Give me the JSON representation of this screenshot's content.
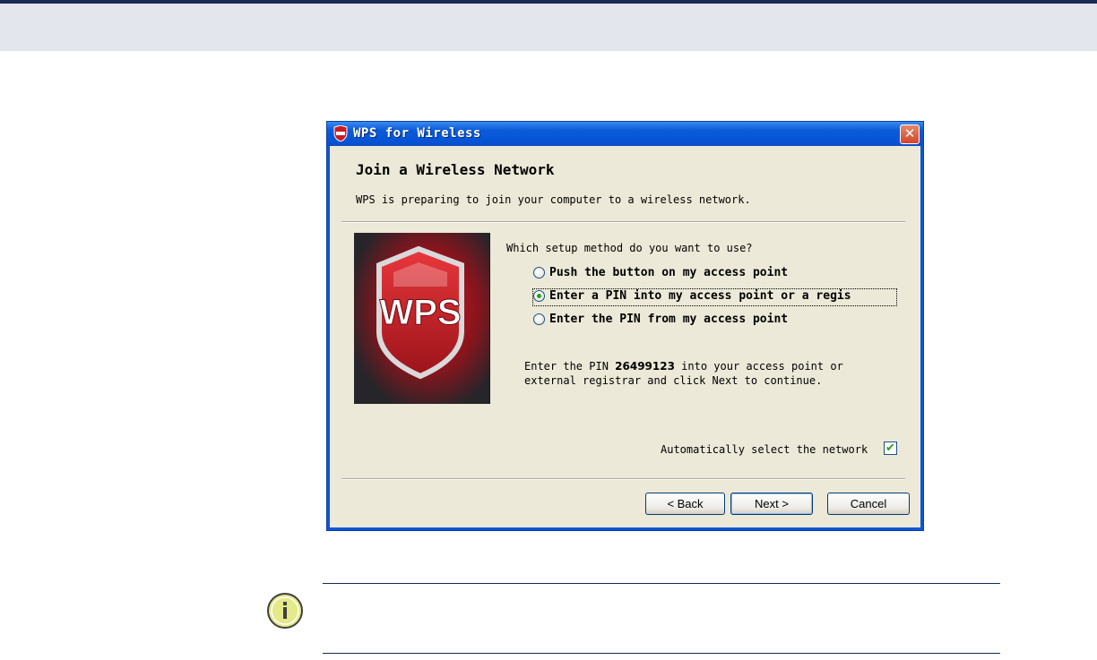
{
  "dialog": {
    "title": "WPS for Wireless",
    "close_label": "✕",
    "heading": "Join a Wireless Network",
    "subheading": "WPS is preparing to join your computer to a wireless network.",
    "banner_logo": "WPS",
    "question": "Which setup method do you want to use?",
    "options": [
      {
        "label": "Push the button on my access point",
        "selected": false
      },
      {
        "label": "Enter a PIN into my access point or a regis",
        "selected": true
      },
      {
        "label": "Enter the PIN from my access point",
        "selected": false
      }
    ],
    "pin_text_before": "Enter the PIN ",
    "pin": "26499123",
    "pin_text_after": " into your access point or external registrar and click Next to continue.",
    "auto_select_label": "Automatically select the network",
    "auto_select_checked": true,
    "buttons": {
      "back": "< Back",
      "next": "Next >",
      "cancel": "Cancel"
    }
  },
  "note": {
    "icon": "info-icon"
  },
  "colors": {
    "titlebar": "#0a5bd9",
    "dialog_bg": "#ece9d8",
    "header_band": "#e3e6ec",
    "accent_red": "#d0222b"
  }
}
